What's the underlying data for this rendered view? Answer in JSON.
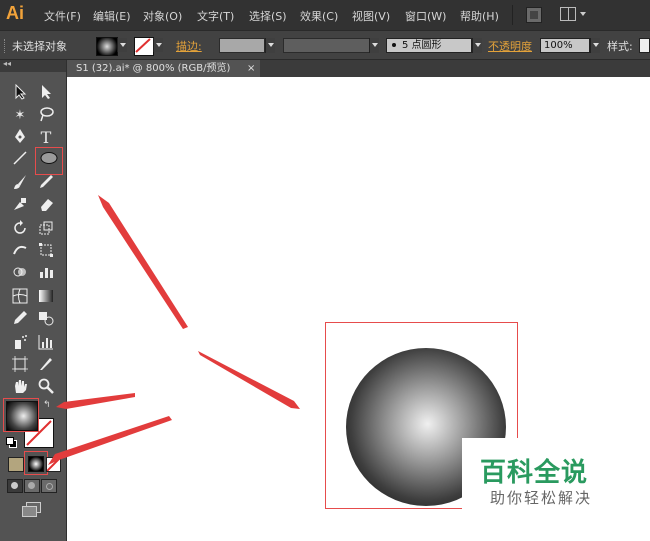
{
  "app": {
    "logo": "Ai"
  },
  "menu": [
    "文件(F)",
    "编辑(E)",
    "对象(O)",
    "文字(T)",
    "选择(S)",
    "效果(C)",
    "视图(V)",
    "窗口(W)",
    "帮助(H)"
  ],
  "control": {
    "selection": "未选择对象",
    "stroke_label": "描边:",
    "brush_value": "5 点圆形",
    "opacity_label": "不透明度",
    "opacity_value": "100%",
    "style_label": "样式:"
  },
  "document": {
    "tab_title": "S1 (32).ai* @ 800% (RGB/预览)",
    "tab_close": "×"
  },
  "panel": {
    "collapse": "◂◂"
  },
  "watermark": {
    "title": "百科全说",
    "subtitle": "助你轻松解决"
  },
  "colors": {
    "accent": "#f2a33a",
    "highlight": "#e64c4c",
    "watermark": "#2a9a5f"
  },
  "icons": [
    "selection-tool-icon",
    "direct-selection-tool-icon",
    "magic-wand-icon",
    "lasso-icon",
    "pen-tool-icon",
    "type-tool-icon",
    "line-tool-icon",
    "ellipse-tool-icon",
    "paintbrush-icon",
    "pencil-icon",
    "blob-brush-icon",
    "eraser-icon",
    "rotate-icon",
    "scale-icon",
    "warp-icon",
    "free-transform-icon",
    "shape-builder-icon",
    "graph-icon",
    "mesh-icon",
    "gradient-icon",
    "eyedropper-icon",
    "blend-icon",
    "symbol-sprayer-icon",
    "column-graph-icon",
    "artboard-icon",
    "slice-icon",
    "hand-icon",
    "zoom-icon"
  ]
}
